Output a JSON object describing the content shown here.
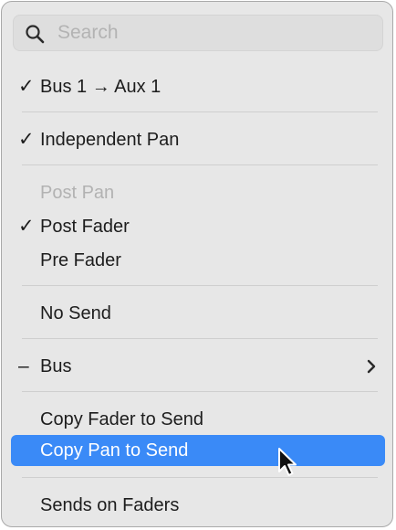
{
  "search": {
    "placeholder": "Search",
    "value": ""
  },
  "menu": {
    "items": [
      {
        "mark": "✓",
        "label": "Bus 1 → Aux 1"
      },
      {
        "mark": "✓",
        "label": "Independent Pan"
      },
      {
        "mark": "",
        "label": "Post Pan",
        "disabled": true
      },
      {
        "mark": "✓",
        "label": "Post Fader"
      },
      {
        "mark": "",
        "label": "Pre Fader"
      },
      {
        "mark": "",
        "label": "No Send"
      },
      {
        "mark": "–",
        "label": "Bus",
        "submenu": true
      },
      {
        "mark": "",
        "label": "Copy Fader to Send"
      },
      {
        "mark": "",
        "label": "Copy Pan to Send",
        "highlighted": true
      },
      {
        "mark": "",
        "label": "Sends on Faders"
      }
    ]
  },
  "colors": {
    "menu_background": "#e7e7e7",
    "highlight": "#3a8af7",
    "disabled_text": "#b2b2b2"
  },
  "icons": {
    "search": "magnifying-glass",
    "submenu": "chevron-right",
    "cursor": "arrow-pointer"
  }
}
